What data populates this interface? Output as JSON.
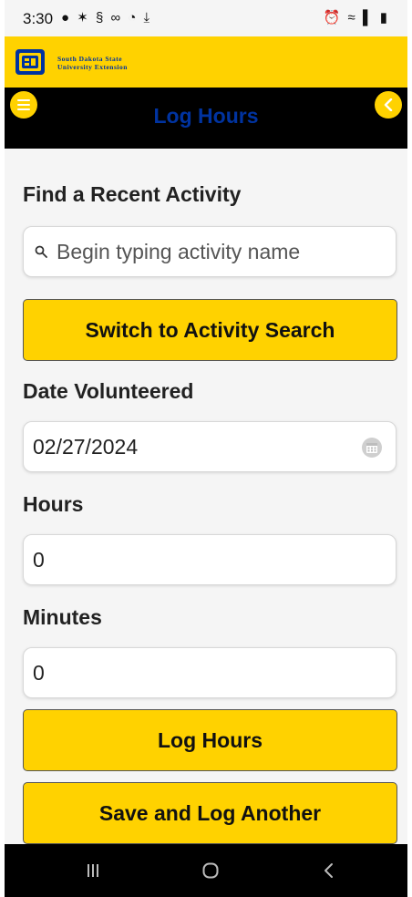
{
  "status_bar": {
    "time": "3:30",
    "left_icons": "● ✶ § ∞ ◔ ⤓",
    "right_icons": "⏰ ≈ ▌ ▮"
  },
  "brand": {
    "line1": "South Dakota State",
    "line2": "University Extension",
    "logo_text": "SD"
  },
  "header": {
    "title": "Log Hours"
  },
  "form": {
    "recent_label": "Find a Recent Activity",
    "search_placeholder": "Begin typing activity name",
    "switch_button": "Switch to Activity Search",
    "date_label": "Date Volunteered",
    "date_value": "02/27/2024",
    "hours_label": "Hours",
    "hours_value": "0",
    "minutes_label": "Minutes",
    "minutes_value": "0",
    "log_button": "Log Hours",
    "save_button": "Save and Log Another"
  },
  "colors": {
    "accent": "#FFD200",
    "brand_blue": "#0033A0",
    "header_bg": "#000000"
  },
  "icons": {
    "menu": "hamburger-menu-icon",
    "back": "chevron-left-icon",
    "search": "search-icon",
    "calendar": "calendar-icon"
  }
}
